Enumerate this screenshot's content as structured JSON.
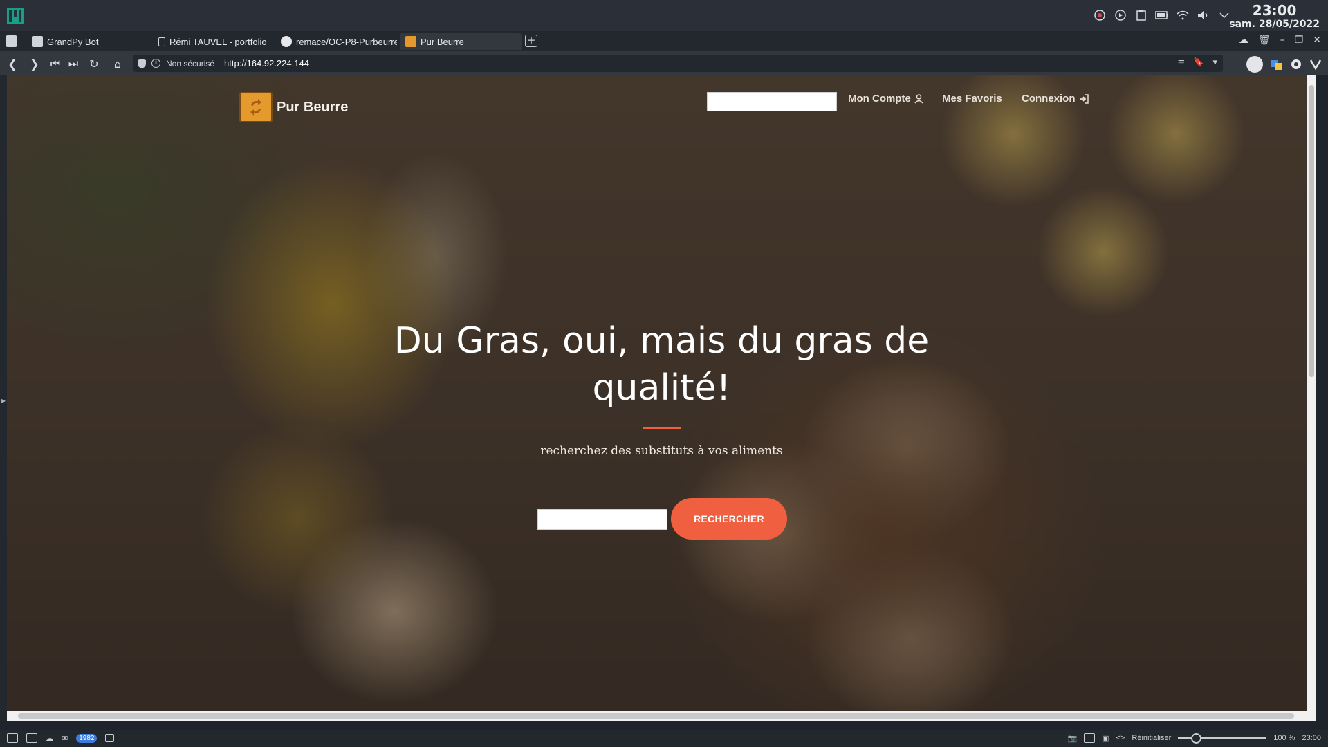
{
  "system": {
    "time": "23:00",
    "date": "sam. 28/05/2022",
    "tray_icons": [
      "update-icon",
      "play-icon",
      "clipboard-icon",
      "battery-icon",
      "wifi-icon",
      "volume-icon",
      "chevron-down-icon"
    ]
  },
  "browser": {
    "tabs": [
      {
        "label": "GrandPy Bot",
        "icon": "robot-favicon",
        "color": "#cfd4da"
      },
      {
        "label": "Rémi TAUVEL - portfolio",
        "icon": "page-favicon",
        "color": "#cfd4da"
      },
      {
        "label": "remace/OC-P8-Purbeurre",
        "icon": "github-favicon",
        "color": "#e6e8eb"
      },
      {
        "label": "Pur Beurre",
        "icon": "purbeurre-favicon",
        "color": "#e59a2e"
      }
    ],
    "new_tab": "+",
    "address": {
      "security": "Non sécurisé",
      "protocol": "http://",
      "host": "164.92.224.144"
    }
  },
  "site": {
    "brand": "Pur Beurre",
    "nav": {
      "account": "Mon Compte",
      "favorites": "Mes Favoris",
      "login": "Connexion"
    },
    "hero": {
      "title_line1": "Du Gras, oui, mais du gras de",
      "title_line2": "qualité!",
      "subtitle": "recherchez des substituts à vos aliments",
      "button": "RECHERCHER"
    },
    "accent_color": "#f05f40"
  },
  "statusbar": {
    "mail_count": "1982",
    "reset": "Réinitialiser",
    "zoom": "100 %",
    "zoom_fraction": 0.2,
    "time": "23:00"
  }
}
